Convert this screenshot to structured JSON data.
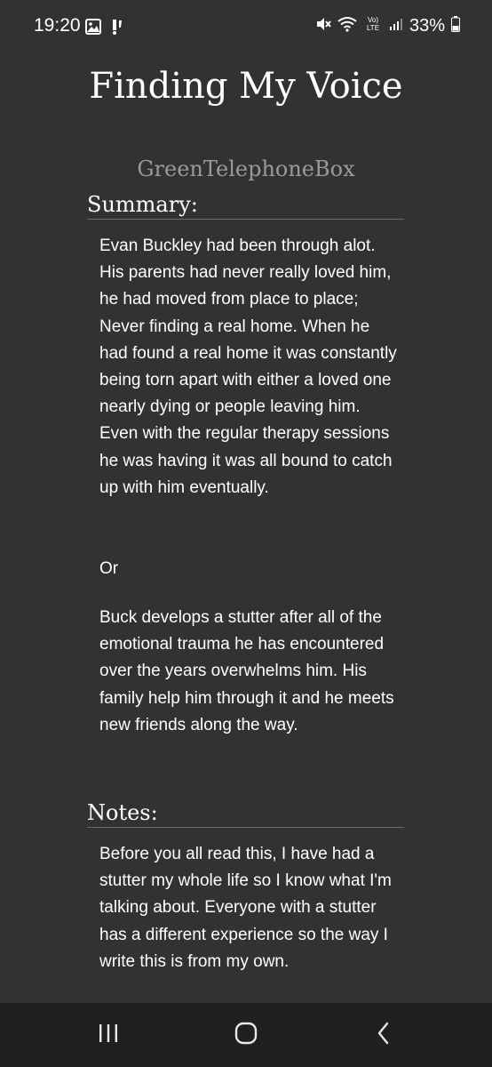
{
  "status_bar": {
    "time": "19:20",
    "battery_percent": "33%",
    "icons": [
      "image-icon",
      "missed-call-icon",
      "mute-icon",
      "wifi-icon",
      "volte-icon",
      "signal-icon",
      "battery-icon"
    ]
  },
  "work": {
    "title": "Finding My Voice",
    "author": "GreenTelephoneBox"
  },
  "summary": {
    "heading": "Summary:",
    "paragraph1": "Evan Buckley had been through alot. His parents had never really loved him, he had moved from place to place; Never finding a real home. When he had found a real home it was constantly being torn apart with either a loved one nearly dying or people leaving him. Even with the regular therapy sessions he was having it was all bound to catch up with him eventually.",
    "paragraph2": "Or",
    "paragraph3": "Buck develops a stutter after all of the emotional trauma he has encountered over the years overwhelms him. His family help him through it and he meets new friends along the way."
  },
  "notes": {
    "heading": "Notes:",
    "paragraph1": "Before you all read this, I have had a stutter my whole life so I know what I'm talking about. Everyone with a stutter has a different experience so the way I write this is from my own."
  },
  "nav": {
    "icons": [
      "recent-apps-icon",
      "home-icon",
      "back-icon"
    ]
  }
}
